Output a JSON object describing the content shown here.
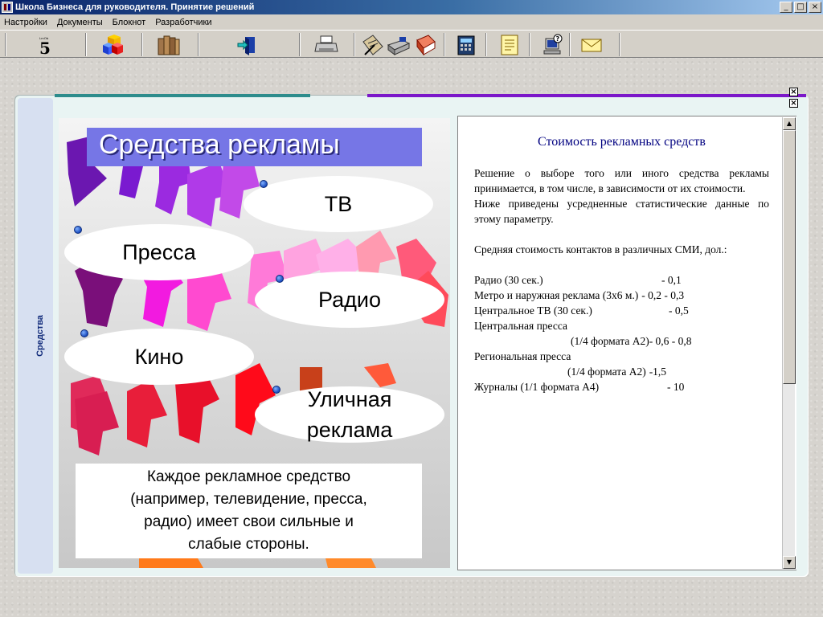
{
  "window": {
    "title": "Школа Бизнеса для руководителя. Принятие решений",
    "minimize": "_",
    "maximize": "□",
    "close": "×"
  },
  "menu": [
    "Настройки",
    "Документы",
    "Блокнот",
    "Разработчики"
  ],
  "toolbar": {
    "icons": [
      "logo-5-icon",
      "cubes-icon",
      "books-icon",
      "exit-door-icon",
      "printer-icon",
      "clipboard-pen-icon",
      "scanner-icon",
      "book-icon",
      "calculator-icon",
      "notes-icon",
      "help-computer-icon",
      "mail-icon"
    ],
    "logo_text": "5"
  },
  "sidetab": {
    "label": "Средства"
  },
  "panel_close": "×",
  "slide": {
    "title": "Средства рекламы",
    "bubbles": {
      "tv": "ТВ",
      "press": "Пресса",
      "radio": "Радио",
      "cinema": "Кино",
      "street_line1": "Уличная",
      "street_line2": "реклама"
    },
    "note": [
      "Каждое рекламное средство",
      "(например, телевидение, пресса,",
      "радио) имеет свои сильные и",
      "слабые стороны."
    ]
  },
  "document": {
    "title": "Стоимость рекламных средств",
    "intro": "Решение о выборе того или иного средства рекламы принимается, в том числе, в зависимости от их стоимости.",
    "intro2": "Ниже приведены усредненные статистические данные по этому параметру.",
    "avg_cost": "Средняя стоимость контактов в различных СМИ, дол.:",
    "rows": [
      {
        "label": "Радио (30 сек.)",
        "value": "- 0,1"
      },
      {
        "label": "Метро и наружная реклама (3х6 м.)",
        "value": "- 0,2 - 0,3"
      },
      {
        "label": "Центральное ТВ (30 сек.)",
        "value": "- 0,5"
      },
      {
        "label": "Центральная пресса",
        "value": ""
      },
      {
        "label": "(1/4 формата А2)",
        "value": "- 0,6 - 0,8"
      },
      {
        "label": "Региональная пресса",
        "value": ""
      },
      {
        "label": "(1/4 формата А2)",
        "value": "-1,5"
      },
      {
        "label": "Журналы (1/1 формата А4)",
        "value": "- 10"
      }
    ]
  },
  "scrollbar": {
    "up": "▲",
    "down": "▼"
  }
}
